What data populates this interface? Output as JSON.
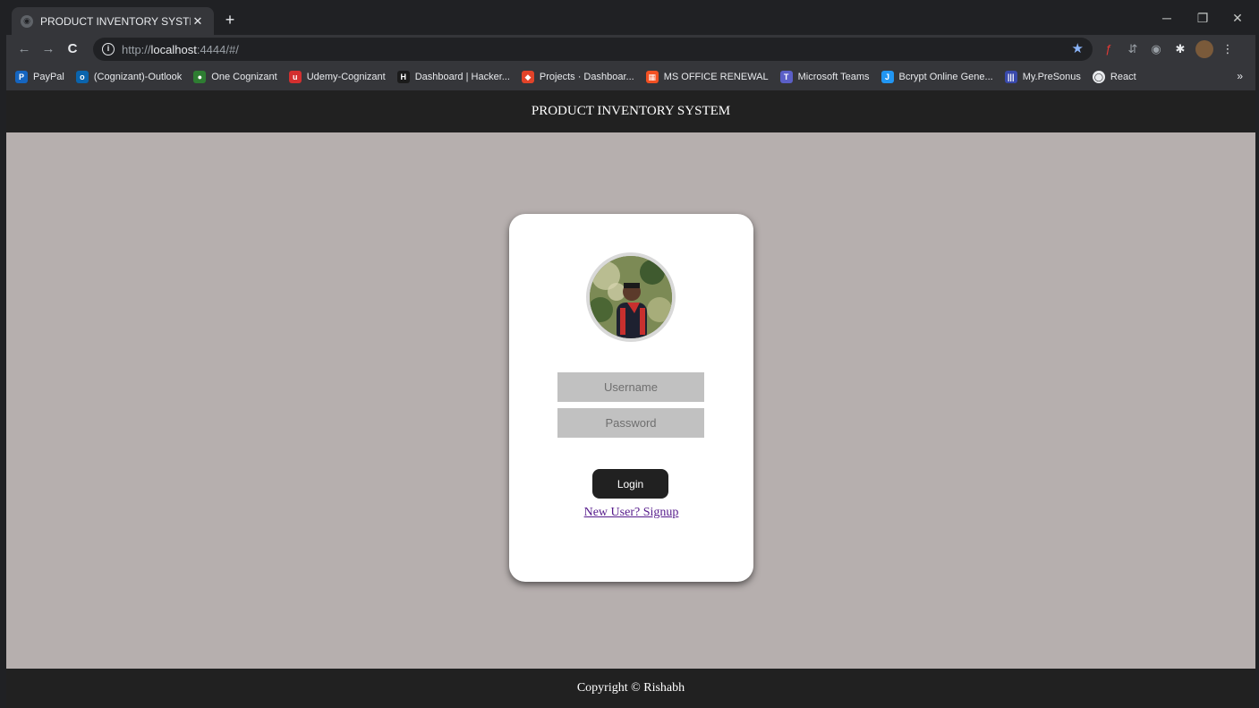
{
  "browser": {
    "tab_title": "PRODUCT INVENTORY SYSTEM",
    "tab_close": "✕",
    "new_tab": "+",
    "url_scheme": "http://",
    "url_host": "localhost",
    "url_rest": ":4444/#/",
    "bookmarks": [
      {
        "label": "PayPal",
        "color": "#1565c0",
        "glyph": "P"
      },
      {
        "label": "(Cognizant)-Outlook",
        "color": "#0a64ad",
        "glyph": "o"
      },
      {
        "label": "One Cognizant",
        "color": "#2e7d32",
        "glyph": "●"
      },
      {
        "label": "Udemy-Cognizant",
        "color": "#d32f2f",
        "glyph": "u"
      },
      {
        "label": "Dashboard | Hacker...",
        "color": "#1b1b1b",
        "glyph": "H"
      },
      {
        "label": "Projects · Dashboar...",
        "color": "#e24329",
        "glyph": "◆"
      },
      {
        "label": "MS OFFICE RENEWAL",
        "color": "#f25022",
        "glyph": "▦"
      },
      {
        "label": "Microsoft Teams",
        "color": "#5b5fc7",
        "glyph": "T"
      },
      {
        "label": "Bcrypt Online Gene...",
        "color": "#2196f3",
        "glyph": "J"
      },
      {
        "label": "My.PreSonus",
        "color": "#3949ab",
        "glyph": "|||"
      },
      {
        "label": "React",
        "color": "#e8eaed",
        "glyph": "◯"
      }
    ],
    "bookmarks_more": "»"
  },
  "app": {
    "header_title": "PRODUCT INVENTORY SYSTEM",
    "login": {
      "username_placeholder": "Username",
      "password_placeholder": "Password",
      "login_label": "Login",
      "signup_link": "New User? Signup"
    },
    "footer_text": "Copyright © Rishabh"
  }
}
